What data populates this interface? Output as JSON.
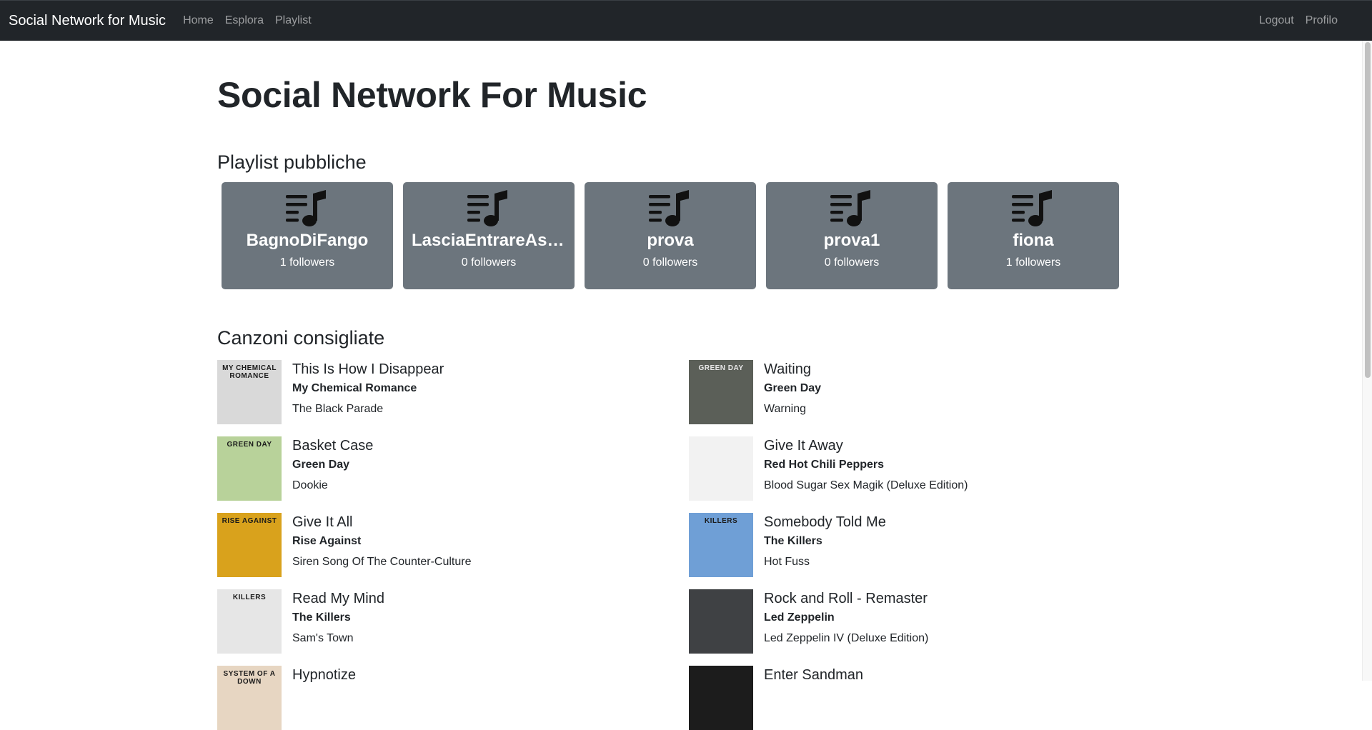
{
  "navbar": {
    "brand": "Social Network for Music",
    "links": [
      "Home",
      "Esplora",
      "Playlist"
    ],
    "right_links": [
      "Logout",
      "Profilo"
    ]
  },
  "page_title": "Social Network For Music",
  "playlists_section": {
    "title": "Playlist pubbliche",
    "items": [
      {
        "name": "BagnoDiFango",
        "followers": "1 followers",
        "icon": "playlist-music-icon"
      },
      {
        "name": "LasciaEntrareAsca…",
        "followers": "0 followers",
        "icon": "playlist-music-icon"
      },
      {
        "name": "prova",
        "followers": "0 followers",
        "icon": "playlist-music-icon"
      },
      {
        "name": "prova1",
        "followers": "0 followers",
        "icon": "playlist-music-icon"
      },
      {
        "name": "fiona",
        "followers": "1 followers",
        "icon": "playlist-music-icon"
      }
    ]
  },
  "songs_section": {
    "title": "Canzoni consigliate",
    "items": [
      {
        "title": "This Is How I Disappear",
        "artist": "My Chemical Romance",
        "album": "The Black Parade",
        "cover_text": "MY CHEMICAL ROMANCE",
        "cover_color": "#d9d9d9"
      },
      {
        "title": "Waiting",
        "artist": "Green Day",
        "album": "Warning",
        "cover_text": "GREEN DAY",
        "cover_color": "#5b5f58"
      },
      {
        "title": "Basket Case",
        "artist": "Green Day",
        "album": "Dookie",
        "cover_text": "GREEN DAY",
        "cover_color": "#b8d29a"
      },
      {
        "title": "Give It Away",
        "artist": "Red Hot Chili Peppers",
        "album": "Blood Sugar Sex Magik (Deluxe Edition)",
        "cover_text": "",
        "cover_color": "#f2f2f2"
      },
      {
        "title": "Give It All",
        "artist": "Rise Against",
        "album": "Siren Song Of The Counter-Culture",
        "cover_text": "RISE AGAINST",
        "cover_color": "#d9a21c"
      },
      {
        "title": "Somebody Told Me",
        "artist": "The Killers",
        "album": "Hot Fuss",
        "cover_text": "KILLERS",
        "cover_color": "#6f9fd6"
      },
      {
        "title": "Read My Mind",
        "artist": "The Killers",
        "album": "Sam's Town",
        "cover_text": "KILLERS",
        "cover_color": "#e6e6e6"
      },
      {
        "title": "Rock and Roll - Remaster",
        "artist": "Led Zeppelin",
        "album": "Led Zeppelin IV (Deluxe Edition)",
        "cover_text": "",
        "cover_color": "#3f4144"
      },
      {
        "title": "Hypnotize",
        "artist": "",
        "album": "",
        "cover_text": "SYSTEM OF A DOWN",
        "cover_color": "#e7d6c2"
      },
      {
        "title": "Enter Sandman",
        "artist": "",
        "album": "",
        "cover_text": "",
        "cover_color": "#1c1c1c"
      }
    ]
  }
}
